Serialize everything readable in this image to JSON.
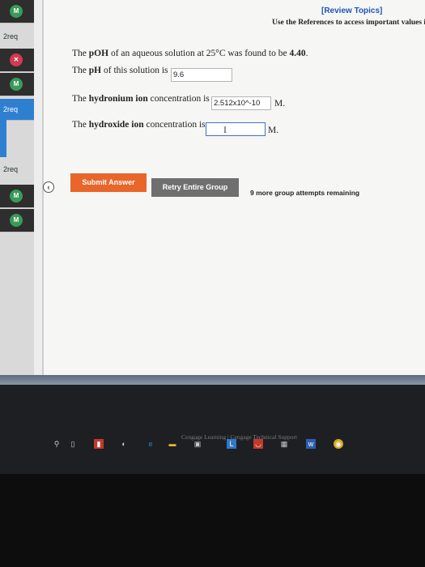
{
  "sidebar": {
    "items": [
      {
        "label": "2req"
      },
      {
        "label": "2req"
      },
      {
        "label": "2req"
      }
    ],
    "badges": [
      "M",
      "✕",
      "M",
      "M",
      "M"
    ]
  },
  "header": {
    "review_link": "[Review Topics]",
    "references_note": "Use the References to access important values if"
  },
  "question": {
    "intro_prefix": "The ",
    "intro_bold": "pOH",
    "intro_mid": " of an aqueous solution at 25°C was found to be ",
    "intro_value": "4.40",
    "intro_end": ".",
    "ph_prefix": "The ",
    "ph_bold": "pH",
    "ph_suffix": " of this solution is",
    "ph_value": "9.6",
    "hyd_prefix": "The ",
    "hyd_bold": "hydronium ion",
    "hyd_suffix": " concentration is",
    "hyd_value": "2.512x10^-10",
    "hyd_unit": "M.",
    "oh_prefix": "The ",
    "oh_bold": "hydroxide ion",
    "oh_suffix": " concentration is",
    "oh_value": "",
    "oh_unit": "M."
  },
  "actions": {
    "submit_label": "Submit Answer",
    "retry_label": "Retry Entire Group",
    "attempts_text": "9 more group attempts remaining"
  },
  "footer": {
    "links": "Cengage Learning  |  Cengage Technical Support"
  },
  "taskbar": {
    "icons": [
      "search-icon",
      "task-view-icon",
      "app-icon",
      "steam-icon",
      "edge-icon",
      "files-icon",
      "store-icon",
      "app-l-icon",
      "mail-icon",
      "calculator-icon",
      "word-icon",
      "chrome-icon"
    ]
  },
  "colors": {
    "submit": "#e8662a",
    "retry": "#6f6f6f",
    "link": "#1f55b8",
    "focus": "#3b6fd8"
  }
}
